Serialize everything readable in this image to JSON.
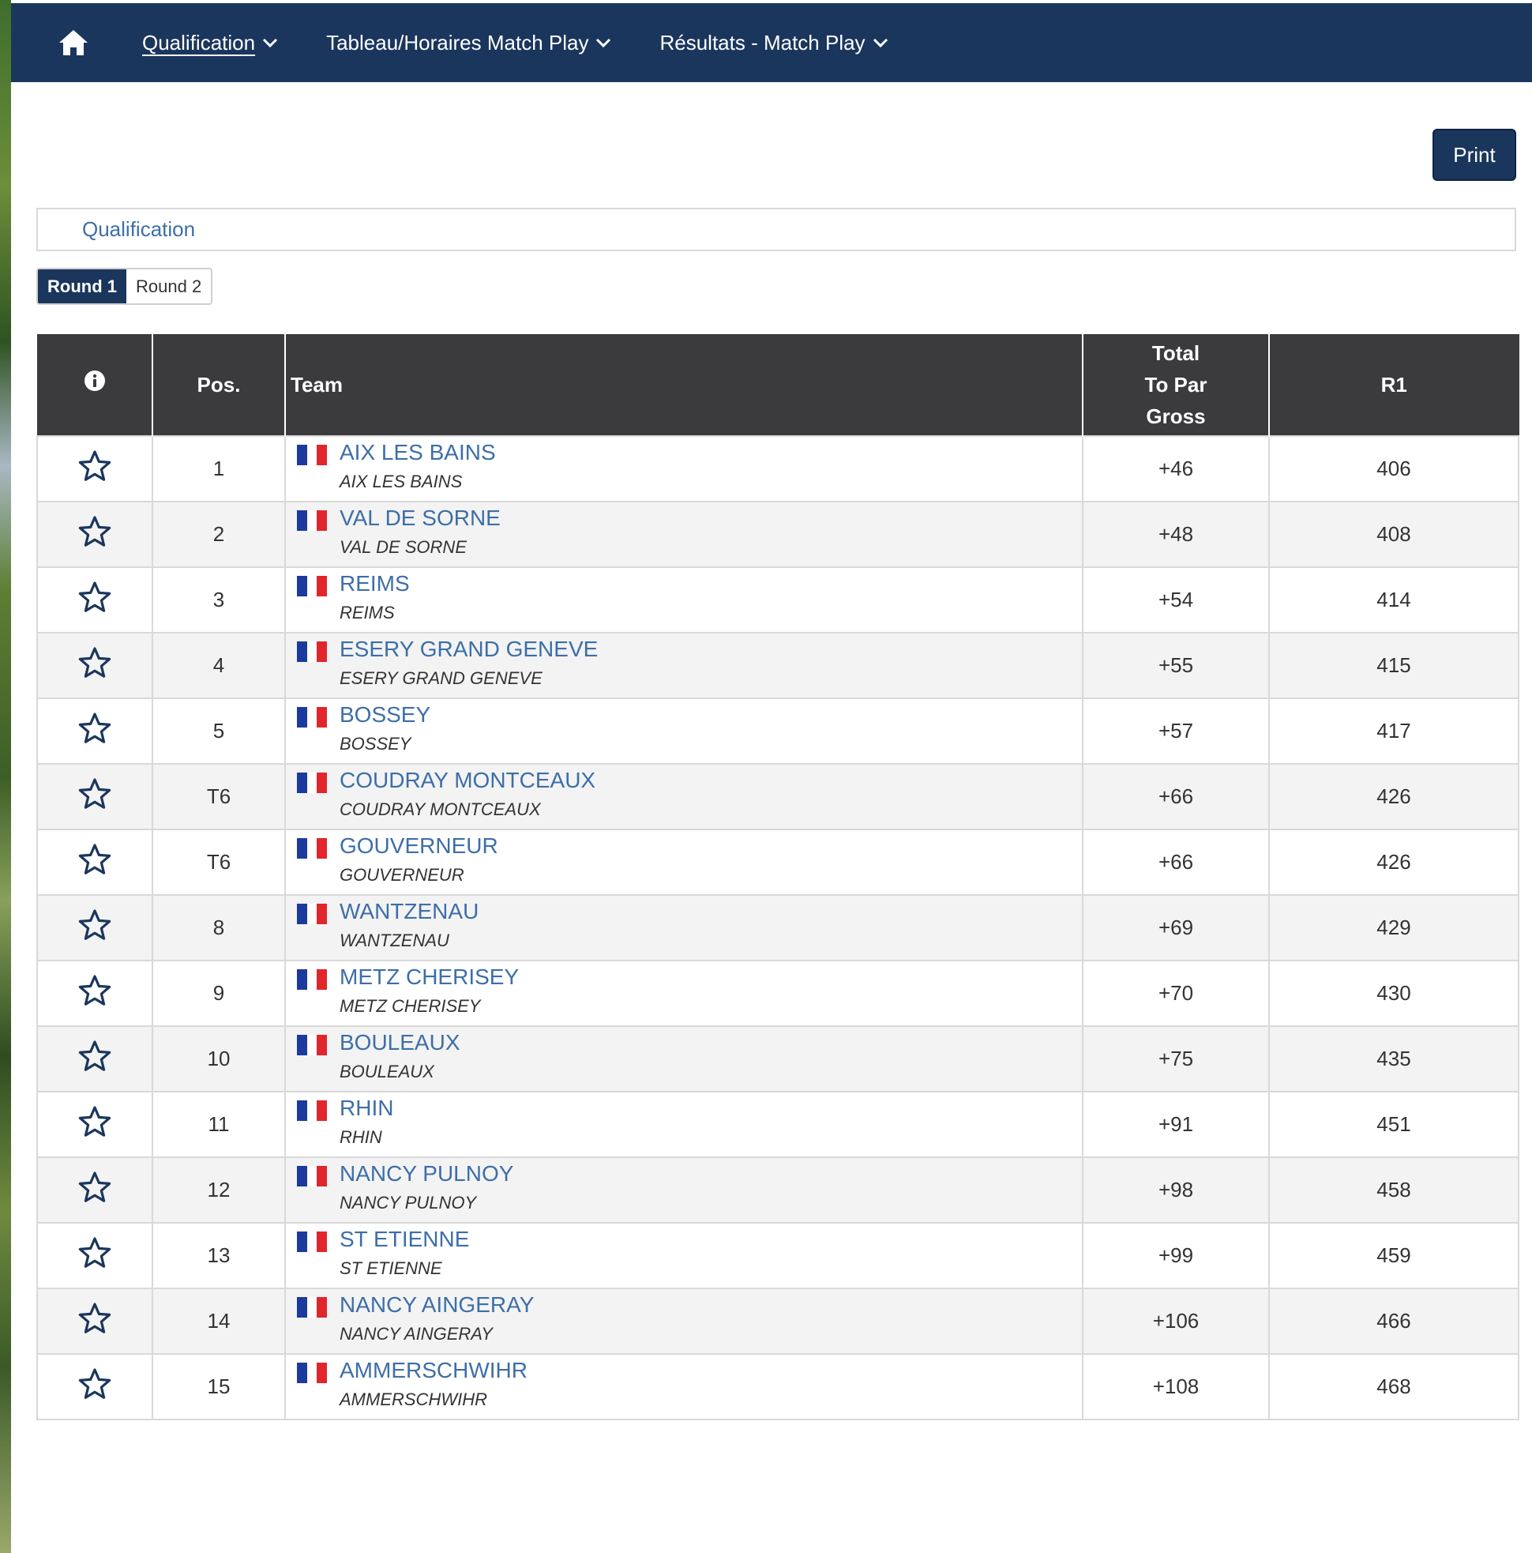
{
  "nav": {
    "items": [
      {
        "label": "Qualification"
      },
      {
        "label": "Tableau/Horaires Match Play"
      },
      {
        "label": "Résultats - Match Play"
      }
    ]
  },
  "print_label": "Print",
  "qualification_label": "Qualification",
  "round_tabs": [
    {
      "label": "Round 1",
      "active": true
    },
    {
      "label": "Round 2",
      "active": false
    }
  ],
  "table": {
    "headers": {
      "pos": "Pos.",
      "team": "Team",
      "total_line1": "Total",
      "total_line2": "To Par",
      "total_line3": "Gross",
      "r1": "R1"
    },
    "rows": [
      {
        "pos": "1",
        "team": "AIX LES BAINS",
        "club": "AIX LES BAINS",
        "to_par": "+46",
        "r1": "406"
      },
      {
        "pos": "2",
        "team": "VAL DE SORNE",
        "club": "VAL DE SORNE",
        "to_par": "+48",
        "r1": "408"
      },
      {
        "pos": "3",
        "team": "REIMS",
        "club": "REIMS",
        "to_par": "+54",
        "r1": "414"
      },
      {
        "pos": "4",
        "team": "ESERY GRAND GENEVE",
        "club": "ESERY GRAND GENEVE",
        "to_par": "+55",
        "r1": "415"
      },
      {
        "pos": "5",
        "team": "BOSSEY",
        "club": "BOSSEY",
        "to_par": "+57",
        "r1": "417"
      },
      {
        "pos": "T6",
        "team": "COUDRAY MONTCEAUX",
        "club": "COUDRAY MONTCEAUX",
        "to_par": "+66",
        "r1": "426"
      },
      {
        "pos": "T6",
        "team": "GOUVERNEUR",
        "club": "GOUVERNEUR",
        "to_par": "+66",
        "r1": "426"
      },
      {
        "pos": "8",
        "team": "WANTZENAU",
        "club": "WANTZENAU",
        "to_par": "+69",
        "r1": "429"
      },
      {
        "pos": "9",
        "team": "METZ CHERISEY",
        "club": "METZ CHERISEY",
        "to_par": "+70",
        "r1": "430"
      },
      {
        "pos": "10",
        "team": "BOULEAUX",
        "club": "BOULEAUX",
        "to_par": "+75",
        "r1": "435"
      },
      {
        "pos": "11",
        "team": "RHIN",
        "club": "RHIN",
        "to_par": "+91",
        "r1": "451"
      },
      {
        "pos": "12",
        "team": "NANCY PULNOY",
        "club": "NANCY PULNOY",
        "to_par": "+98",
        "r1": "458"
      },
      {
        "pos": "13",
        "team": "ST ETIENNE",
        "club": "ST ETIENNE",
        "to_par": "+99",
        "r1": "459"
      },
      {
        "pos": "14",
        "team": "NANCY AINGERAY",
        "club": "NANCY AINGERAY",
        "to_par": "+106",
        "r1": "466"
      },
      {
        "pos": "15",
        "team": "AMMERSCHWIHR",
        "club": "AMMERSCHWIHR",
        "to_par": "+108",
        "r1": "468"
      }
    ]
  },
  "icons": {
    "home": "home-icon",
    "info": "info-icon",
    "star": "star-outline-icon",
    "flag": "france-flag-icon",
    "chevron": "chevron-down-icon"
  },
  "colors": {
    "nav_bg": "#1b365d",
    "header_bg": "#3b3b3d",
    "link": "#3d6ea8",
    "flag_blue": "#1c3a9e",
    "flag_red": "#e0262c"
  }
}
